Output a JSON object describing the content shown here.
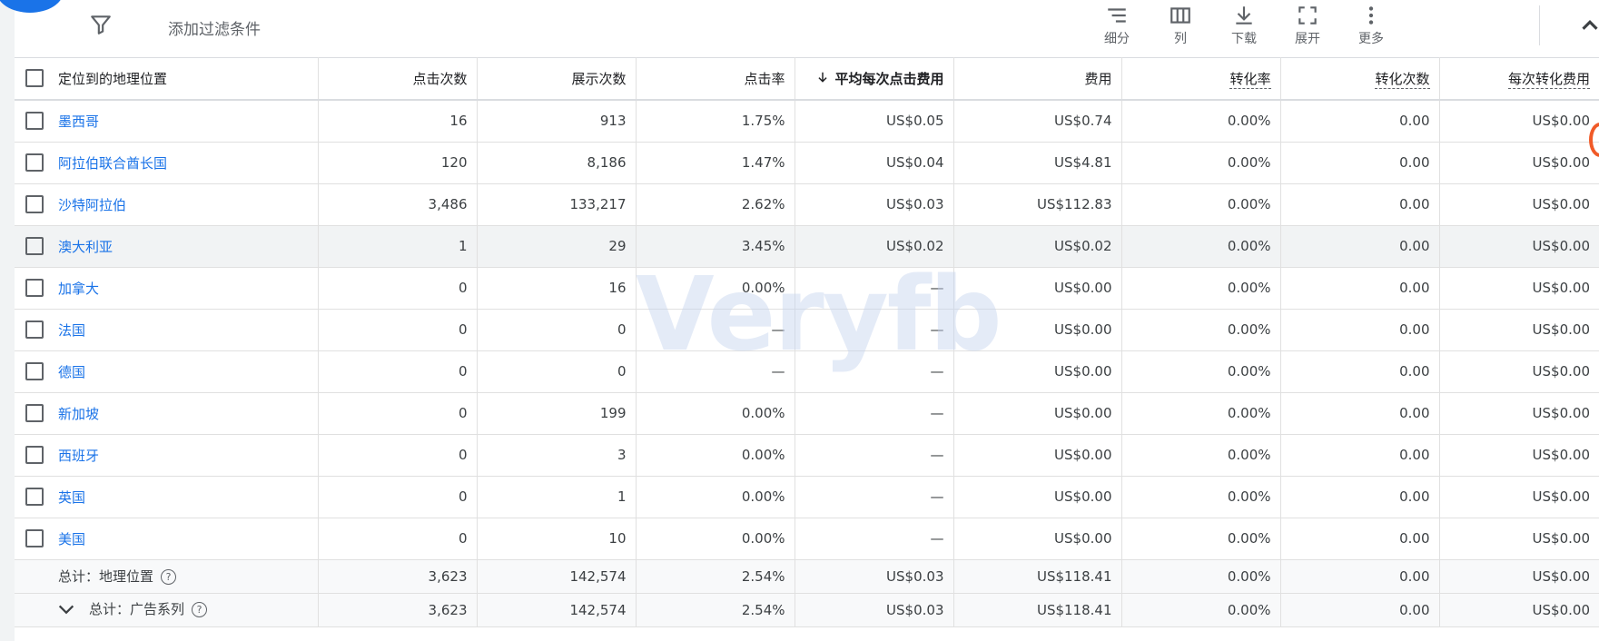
{
  "toolbar": {
    "filter_label": "添加过滤条件",
    "tools": [
      {
        "label": "细分",
        "icon": "segment-icon"
      },
      {
        "label": "列",
        "icon": "columns-icon"
      },
      {
        "label": "下载",
        "icon": "download-icon"
      },
      {
        "label": "展开",
        "icon": "fullscreen-icon"
      },
      {
        "label": "更多",
        "icon": "more-vert-icon"
      }
    ]
  },
  "table": {
    "headers": [
      "定位到的地理位置",
      "点击次数",
      "展示次数",
      "点击率",
      "平均每次点击费用",
      "费用",
      "转化率",
      "转化次数",
      "每次转化费用"
    ],
    "rows": [
      {
        "name": "墨西哥",
        "clicks": "16",
        "impr": "913",
        "ctr": "1.75%",
        "cpc": "US$0.05",
        "cost": "US$0.74",
        "cvr": "0.00%",
        "conv": "0.00",
        "cpa": "US$0.00"
      },
      {
        "name": "阿拉伯联合酋长国",
        "clicks": "120",
        "impr": "8,186",
        "ctr": "1.47%",
        "cpc": "US$0.04",
        "cost": "US$4.81",
        "cvr": "0.00%",
        "conv": "0.00",
        "cpa": "US$0.00"
      },
      {
        "name": "沙特阿拉伯",
        "clicks": "3,486",
        "impr": "133,217",
        "ctr": "2.62%",
        "cpc": "US$0.03",
        "cost": "US$112.83",
        "cvr": "0.00%",
        "conv": "0.00",
        "cpa": "US$0.00"
      },
      {
        "name": "澳大利亚",
        "clicks": "1",
        "impr": "29",
        "ctr": "3.45%",
        "cpc": "US$0.02",
        "cost": "US$0.02",
        "cvr": "0.00%",
        "conv": "0.00",
        "cpa": "US$0.00"
      },
      {
        "name": "加拿大",
        "clicks": "0",
        "impr": "16",
        "ctr": "0.00%",
        "cpc": "—",
        "cost": "US$0.00",
        "cvr": "0.00%",
        "conv": "0.00",
        "cpa": "US$0.00"
      },
      {
        "name": "法国",
        "clicks": "0",
        "impr": "0",
        "ctr": "—",
        "cpc": "—",
        "cost": "US$0.00",
        "cvr": "0.00%",
        "conv": "0.00",
        "cpa": "US$0.00"
      },
      {
        "name": "德国",
        "clicks": "0",
        "impr": "0",
        "ctr": "—",
        "cpc": "—",
        "cost": "US$0.00",
        "cvr": "0.00%",
        "conv": "0.00",
        "cpa": "US$0.00"
      },
      {
        "name": "新加坡",
        "clicks": "0",
        "impr": "199",
        "ctr": "0.00%",
        "cpc": "—",
        "cost": "US$0.00",
        "cvr": "0.00%",
        "conv": "0.00",
        "cpa": "US$0.00"
      },
      {
        "name": "西班牙",
        "clicks": "0",
        "impr": "3",
        "ctr": "0.00%",
        "cpc": "—",
        "cost": "US$0.00",
        "cvr": "0.00%",
        "conv": "0.00",
        "cpa": "US$0.00"
      },
      {
        "name": "英国",
        "clicks": "0",
        "impr": "1",
        "ctr": "0.00%",
        "cpc": "—",
        "cost": "US$0.00",
        "cvr": "0.00%",
        "conv": "0.00",
        "cpa": "US$0.00"
      },
      {
        "name": "美国",
        "clicks": "0",
        "impr": "10",
        "ctr": "0.00%",
        "cpc": "—",
        "cost": "US$0.00",
        "cvr": "0.00%",
        "conv": "0.00",
        "cpa": "US$0.00"
      }
    ],
    "totals": [
      {
        "name": "总计：地理位置",
        "clicks": "3,623",
        "impr": "142,574",
        "ctr": "2.54%",
        "cpc": "US$0.03",
        "cost": "US$118.41",
        "cvr": "0.00%",
        "conv": "0.00",
        "cpa": "US$0.00"
      },
      {
        "name": "总计：广告系列",
        "clicks": "3,623",
        "impr": "142,574",
        "ctr": "2.54%",
        "cpc": "US$0.03",
        "cost": "US$118.41",
        "cvr": "0.00%",
        "conv": "0.00",
        "cpa": "US$0.00"
      }
    ]
  },
  "watermark": "Veryfb"
}
